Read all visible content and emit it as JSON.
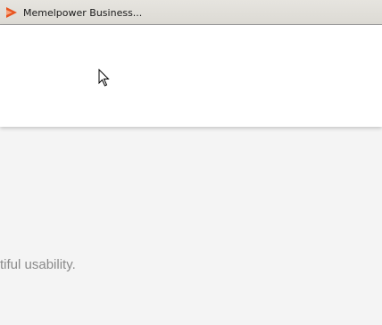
{
  "window": {
    "title": "Memelpower Business...",
    "app_icon": "memelpower-logo-icon",
    "accent": "#e8541f"
  },
  "main": {
    "tagline": "tiful usability."
  },
  "cursor": {
    "icon": "mouse-pointer-icon"
  }
}
